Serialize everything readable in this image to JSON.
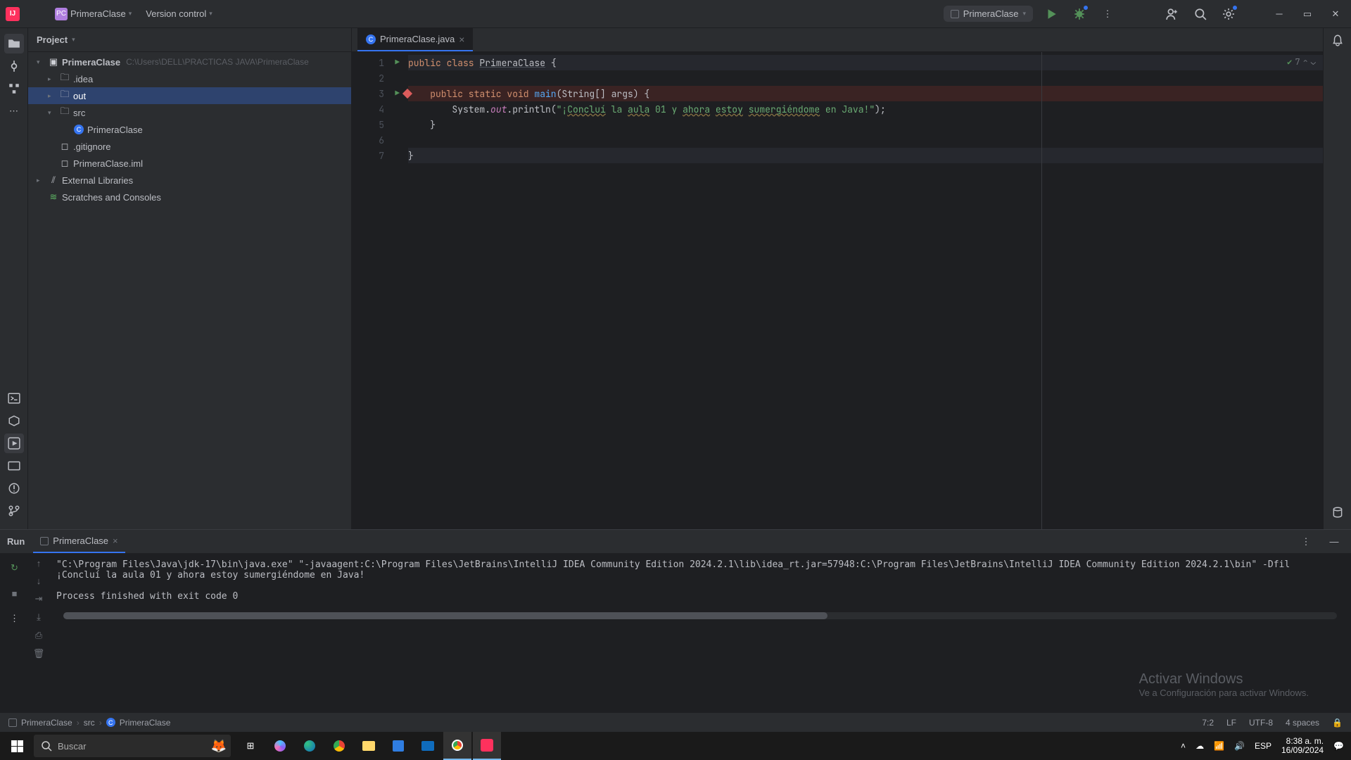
{
  "topbar": {
    "project_name": "PrimeraClase",
    "version_control": "Version control",
    "run_config": "PrimeraClase"
  },
  "project": {
    "title": "Project",
    "root": {
      "name": "PrimeraClase",
      "path": "C:\\Users\\DELL\\PRACTICAS JAVA\\PrimeraClase"
    },
    "folders": {
      "idea": ".idea",
      "out": "out",
      "src": "src"
    },
    "class_file": "PrimeraClase",
    "gitignore": ".gitignore",
    "iml": "PrimeraClase.iml",
    "external": "External Libraries",
    "scratches": "Scratches and Consoles"
  },
  "editor": {
    "tab": "PrimeraClase.java",
    "lines": {
      "l1a": "public class ",
      "l1b": "PrimeraClase",
      "l1c": " {",
      "l3a": "    public static void ",
      "l3b": "main",
      "l3c": "(String[] args) {",
      "l4a": "        System.",
      "l4b": "out",
      "l4c": ".println(",
      "l4d": "\"¡",
      "l4e": "Concluí",
      "l4f": " la ",
      "l4g": "aula",
      "l4h": " 01 y ",
      "l4i": "ahora",
      "l4j": " ",
      "l4k": "estoy",
      "l4l": " ",
      "l4m": "sumergiéndome",
      "l4n": " en Java!\"",
      "l4o": ");",
      "l5": "    }",
      "l7": "}"
    },
    "gutter": [
      "1",
      "2",
      "3",
      "4",
      "5",
      "6",
      "7"
    ],
    "problems_count": "7"
  },
  "run": {
    "label": "Run",
    "tab": "PrimeraClase",
    "output_line1": "\"C:\\Program Files\\Java\\jdk-17\\bin\\java.exe\" \"-javaagent:C:\\Program Files\\JetBrains\\IntelliJ IDEA Community Edition 2024.2.1\\lib\\idea_rt.jar=57948:C:\\Program Files\\JetBrains\\IntelliJ IDEA Community Edition 2024.2.1\\bin\" -Dfil",
    "output_line2": "¡Concluí la aula 01 y ahora estoy sumergiéndome en Java!",
    "output_line3": "",
    "output_line4": "Process finished with exit code 0"
  },
  "watermark": {
    "title": "Activar Windows",
    "sub": "Ve a Configuración para activar Windows."
  },
  "status": {
    "crumb1": "PrimeraClase",
    "crumb2": "src",
    "crumb3": "PrimeraClase",
    "pos": "7:2",
    "eol": "LF",
    "enc": "UTF-8",
    "indent": "4 spaces"
  },
  "taskbar": {
    "search_placeholder": "Buscar",
    "lang": "ESP",
    "time": "8:38 a. m.",
    "date": "16/09/2024"
  }
}
